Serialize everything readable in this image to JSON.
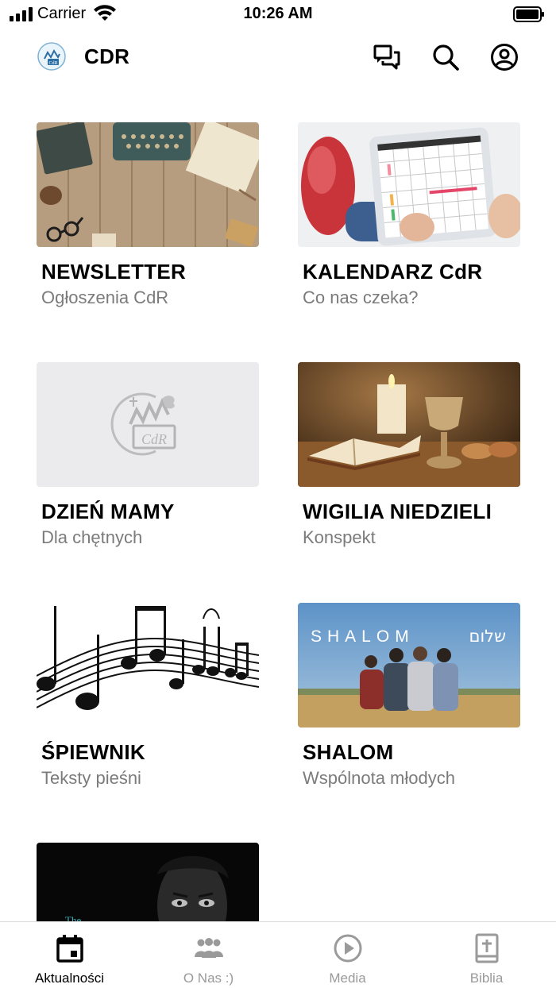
{
  "status_bar": {
    "carrier": "Carrier",
    "time": "10:26 AM"
  },
  "header": {
    "title": "CDR",
    "icons": [
      "chat-icon",
      "search-icon",
      "account-icon"
    ]
  },
  "cards": [
    {
      "title": "NEWSLETTER",
      "subtitle": "Ogłoszenia CdR",
      "image": "desk-typewriter"
    },
    {
      "title": "KALENDARZ CdR",
      "subtitle": "Co nas czeka?",
      "image": "tablet-calendar"
    },
    {
      "title": "DZIEŃ MAMY",
      "subtitle": "Dla chętnych",
      "image": "cdr-logo-placeholder"
    },
    {
      "title": "WIGILIA NIEDZIELI",
      "subtitle": "Konspekt",
      "image": "candle-bible-chalice"
    },
    {
      "title": "ŚPIEWNIK",
      "subtitle": "Teksty pieśni",
      "image": "music-staff-notes"
    },
    {
      "title": "SHALOM",
      "subtitle": "Wspólnota młodych",
      "image": "shalom-group",
      "image_text": "SHALOM",
      "image_text_hebrew": "שלום"
    },
    {
      "title": "",
      "subtitle": "",
      "image": "portrait-dark",
      "image_text": "The"
    }
  ],
  "tabbar": {
    "tabs": [
      {
        "label": "Aktualności",
        "icon": "calendar-icon",
        "active": true
      },
      {
        "label": "O Nas :)",
        "icon": "group-icon",
        "active": false
      },
      {
        "label": "Media",
        "icon": "play-icon",
        "active": false
      },
      {
        "label": "Biblia",
        "icon": "bible-icon",
        "active": false
      }
    ]
  },
  "colors": {
    "accent": "#000000",
    "inactive": "#9a9a9a",
    "subtitle": "#7b7b7b",
    "placeholder_bg": "#ebebed"
  }
}
